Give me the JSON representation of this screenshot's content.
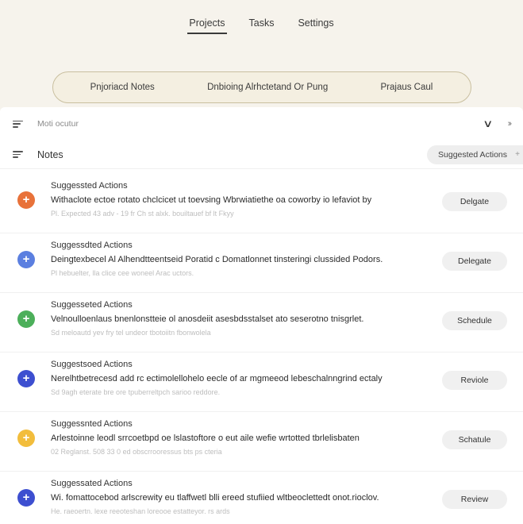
{
  "nav": {
    "tabs": [
      "Projects",
      "Tasks",
      "Settings"
    ],
    "active": "Projects"
  },
  "pill": {
    "segments": [
      "Pnjoriacd Notes",
      "Dnbioing Alrhctetand Or Pung",
      "Prajaus Caul"
    ]
  },
  "filter": {
    "placeholder": "Moti ocutur"
  },
  "notes": {
    "title": "Notes",
    "suggested_button": "Suggested Actions"
  },
  "items": [
    {
      "title": "Suggessted Actions",
      "desc": "Withaclote ectoe rotato chclcicet ut toevsing Wbrwiatiethe oa coworby io lefaviot by",
      "meta": "Pl. Expected 43 adv - 19 fr Ch st alxk. bouiltauef bf lt Fkyy",
      "action": "Delgate",
      "color": "#e8723a"
    },
    {
      "title": "Suggessdted Actions",
      "desc": "Deingtexbecel Al Alhendtteentseid Poratid c Domatlonnet tinsteringi clussided Podors.",
      "meta": "Pl hebuelter, lla clice cee woneel Arac uctors.",
      "action": "Delegate",
      "color": "#5b7fe0"
    },
    {
      "title": "Suggesseted Actions",
      "desc": "Velnoulloenlaus bnenlonstteie ol anosdeiit asesbdsstalset ato seserotno tnisgrlet.",
      "meta": "Sd meloautd yev fry tel undeor tbotoiitn fbonwolela",
      "action": "Schedule",
      "color": "#4caf5a"
    },
    {
      "title": "Suggestsoed Actions",
      "desc": "Nerelhtbetrecesd add rc ectimolellohelo eecle of ar mgmeeod lebeschalnngrind ectaly",
      "meta": "Sd 9agh eterate bre ore tpuberreltpch sarioo reddore.",
      "action": "Reviole",
      "color": "#3d4fd0"
    },
    {
      "title": "Suggessnted Actions",
      "desc": "Arlestoinne leodl srrcoetbpd oe lslastoftore o eut aile wefie wrtotted tbrlelisbaten",
      "meta": "02 Reglanst. 508 33 0 ed obscrrooressus bts ps cteria",
      "action": "Schatule",
      "color": "#f2bd3c"
    },
    {
      "title": "Suggessated Actions",
      "desc": "Wi. fomattocebod arlscrewity eu tlaffwetl blli ereed stufiied wltbeoclettedt onot.rioclov.",
      "meta": "He. raeoertn. lexe reeoteshan loreooe estatteyor. rs ards",
      "action": "Review",
      "color": "#3d4fd0"
    }
  ]
}
